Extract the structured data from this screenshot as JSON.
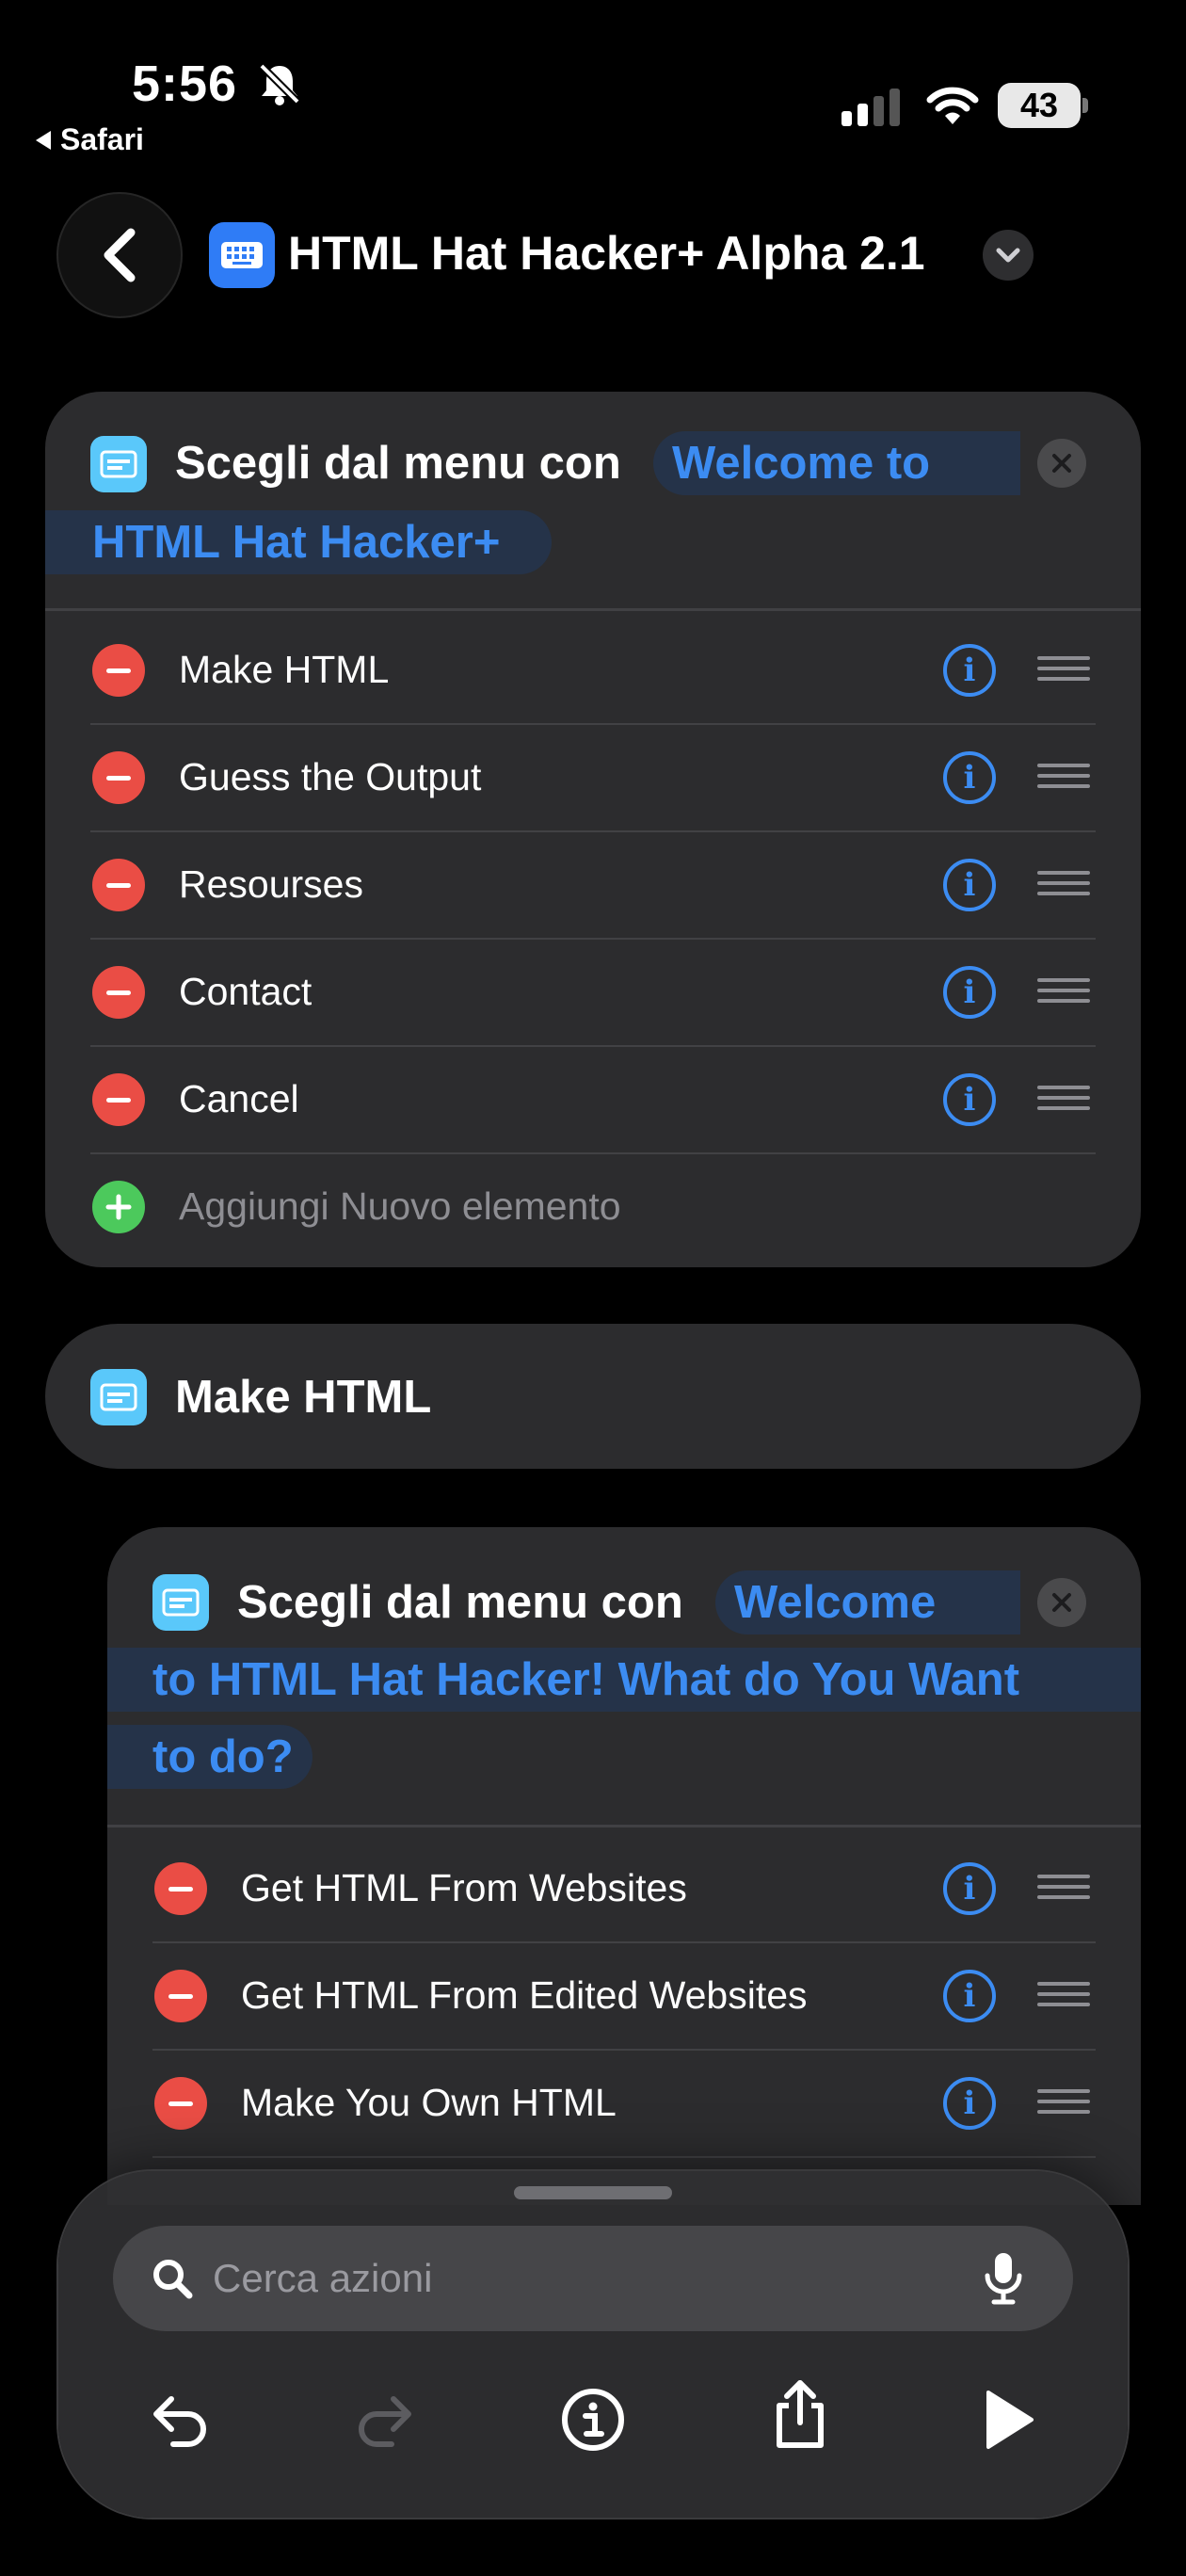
{
  "status_bar": {
    "time": "5:56",
    "back_app": "Safari",
    "battery": "43",
    "icons": [
      "bell-slash-icon",
      "cellular-signal-icon",
      "wifi-icon",
      "battery-icon"
    ]
  },
  "nav": {
    "title": "HTML Hat Hacker+ Alpha 2.1",
    "icons": [
      "chevron-left-icon",
      "keyboard-app-icon",
      "chevron-down-icon"
    ]
  },
  "menu1": {
    "action_label": "Scegli dal menu con",
    "token_line1": "Welcome to",
    "token_line2": "HTML Hat Hacker+",
    "items": [
      "Make HTML",
      "Guess the Output",
      "Resourses",
      "Contact",
      "Cancel"
    ],
    "add_label": "Aggiungi Nuovo elemento"
  },
  "case_block": {
    "label": "Make HTML"
  },
  "menu2": {
    "action_label": "Scegli dal menu con",
    "token_line1": "Welcome",
    "token_line2": "to HTML Hat Hacker! What do You Want",
    "token_line3": "to do?",
    "items": [
      "Get HTML From Websites",
      "Get HTML From Edited Websites",
      "Make You Own HTML"
    ]
  },
  "toolbar": {
    "search_placeholder": "Cerca azioni",
    "buttons": [
      "undo-icon",
      "redo-icon",
      "info-icon",
      "share-icon",
      "play-icon"
    ]
  },
  "colors": {
    "background": "#000000",
    "card": "#2c2c2e",
    "accent_blue": "#3c8cf2",
    "remove_red": "#ea4d45",
    "add_green": "#4cc95c",
    "action_icon": "#5ac8fa"
  }
}
